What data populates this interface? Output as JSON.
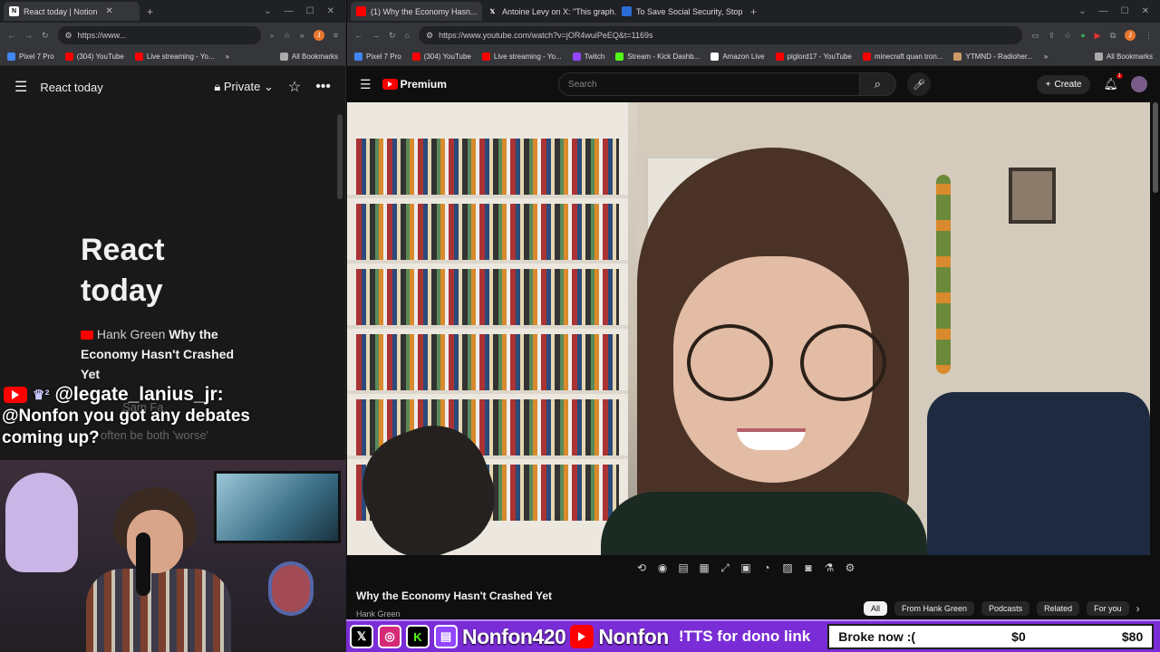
{
  "left_browser": {
    "tab_title": "React today | Notion",
    "url": "https://www...",
    "bookmarks": [
      "Pixel 7 Pro",
      "(304) YouTube",
      "Live streaming - Yo...",
      "All Bookmarks"
    ]
  },
  "notion": {
    "header_title": "React today",
    "visibility": "Private",
    "page_title_line1": "React",
    "page_title_line2": "today",
    "item_channel": "Hank Green",
    "item_title": "Why the Economy Hasn't Crashed Yet",
    "faded_text_1": "Sam Fa",
    "faded_text_2": "often be both 'worse'"
  },
  "chat": {
    "username": "@legate_lanius_jr:",
    "message": "@Nonfon you got any debates coming up?"
  },
  "right_browser": {
    "tabs": [
      {
        "title": "(1) Why the Economy Hasn...",
        "active": true
      },
      {
        "title": "Antoine Levy on X: \"This graph...",
        "active": false
      },
      {
        "title": "To Save Social Security, Stop S...",
        "active": false
      }
    ],
    "url": "https://www.youtube.com/watch?v=jOR4wuiPeEQ&t=1169s",
    "bookmarks": [
      "Pixel 7 Pro",
      "(304) YouTube",
      "Live streaming - Yo...",
      "Twitch",
      "Stream - Kick Dashb...",
      "Amazon Live",
      "piglord17 - YouTube",
      "minecraft quan tron...",
      "YTMND - Radioher...",
      "All Bookmarks"
    ]
  },
  "youtube": {
    "logo_text": "Premium",
    "search_placeholder": "Search",
    "create_label": "Create",
    "notif_count": "1",
    "video_title": "Why the Economy Hasn't Crashed Yet",
    "channel": "Hank Green",
    "chips": [
      "All",
      "From Hank Green",
      "Podcasts",
      "Related",
      "For you"
    ]
  },
  "streambar": {
    "twitch_name": "Nonfon420",
    "youtube_name": "Nonfon",
    "tts_text": "!TTS for dono link",
    "goal_label": "Broke now :(",
    "goal_current": "$0",
    "goal_target": "$80"
  },
  "colors": {
    "accent_purple": "#7a2dd6",
    "youtube_red": "#ff0000"
  }
}
